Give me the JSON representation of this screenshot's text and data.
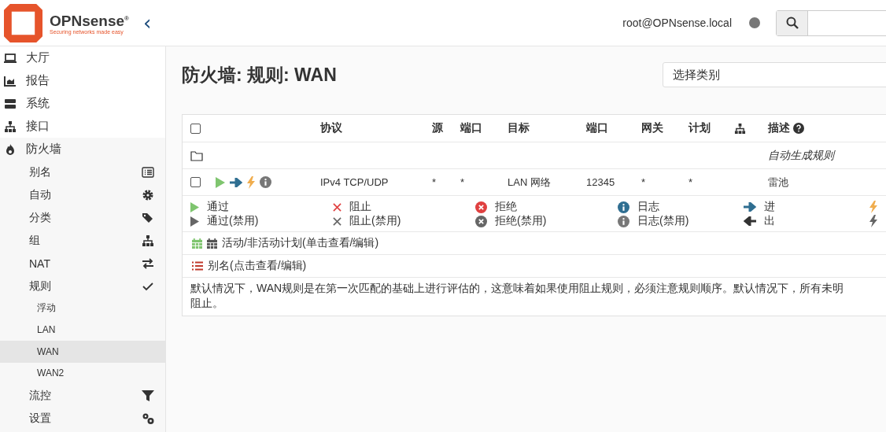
{
  "header": {
    "logo_name": "OPNsense",
    "logo_mark": "®",
    "logo_tagline": "Securing networks made easy",
    "collapse_icon": "‹",
    "user": "root@OPNsense.local"
  },
  "sidebar": {
    "items": [
      {
        "label": "大厅",
        "selected": false
      },
      {
        "label": "报告",
        "selected": false
      },
      {
        "label": "系统",
        "selected": false
      },
      {
        "label": "接口",
        "selected": false
      },
      {
        "label": "防火墙",
        "selected": false,
        "expanded": true,
        "children": [
          {
            "label": "别名",
            "selected": false
          },
          {
            "label": "自动",
            "selected": false
          },
          {
            "label": "分类",
            "selected": false
          },
          {
            "label": "组",
            "selected": false
          },
          {
            "label": "NAT",
            "selected": false
          },
          {
            "label": "规则",
            "selected": false,
            "expanded": true,
            "children": [
              {
                "label": "浮动",
                "selected": false
              },
              {
                "label": "LAN",
                "selected": false
              },
              {
                "label": "WAN",
                "selected": true
              },
              {
                "label": "WAN2",
                "selected": false
              }
            ]
          },
          {
            "label": "流控",
            "selected": false
          },
          {
            "label": "设置",
            "selected": false
          }
        ]
      }
    ]
  },
  "page": {
    "title": "防火墙: 规则: WAN",
    "category_select": {
      "placeholder": "选择类别"
    }
  },
  "table": {
    "columns": [
      {
        "label": "协议"
      },
      {
        "label": "源"
      },
      {
        "label": "端口"
      },
      {
        "label": "目标"
      },
      {
        "label": "端口"
      },
      {
        "label": "网关"
      },
      {
        "label": "计划"
      },
      {
        "label": "描述"
      }
    ],
    "header_checked": false,
    "rows": [
      {
        "kind": "category",
        "description": "自动生成规则"
      },
      {
        "kind": "rule",
        "checked": false,
        "quick": true,
        "log": false,
        "protocol": "IPv4 TCP/UDP",
        "source": "*",
        "source_port": "*",
        "destination": "LAN 网络",
        "destination_port": "12345",
        "gateway": "*",
        "schedule": "*",
        "description": "雷池"
      }
    ]
  },
  "legend": [
    [
      {
        "kind": "pass",
        "label": "通过"
      },
      {
        "kind": "block",
        "label": "阻止"
      },
      {
        "kind": "reject",
        "label": "拒绝"
      },
      {
        "kind": "log",
        "label": "日志"
      },
      {
        "kind": "in",
        "label": "进"
      },
      {
        "kind": "quick"
      }
    ],
    [
      {
        "kind": "pass-disabled",
        "label": "通过(禁用)"
      },
      {
        "kind": "block-disabled",
        "label": "阻止(禁用)"
      },
      {
        "kind": "reject-disabled",
        "label": "拒绝(禁用)"
      },
      {
        "kind": "log-disabled",
        "label": "日志(禁用)"
      },
      {
        "kind": "out",
        "label": "出"
      },
      {
        "kind": "quick-disabled"
      }
    ]
  ],
  "schedule_note": "活动/非活动计划(单击查看/编辑)",
  "alias_note": "别名(点击查看/编辑)",
  "info_lines": [
    "默认情况下，WAN规则是在第一次匹配的基础上进行评估的，这意味着如果使用阻止规则，必须注意规则顺序。默认情况下，所有未明",
    "阻止。"
  ]
}
